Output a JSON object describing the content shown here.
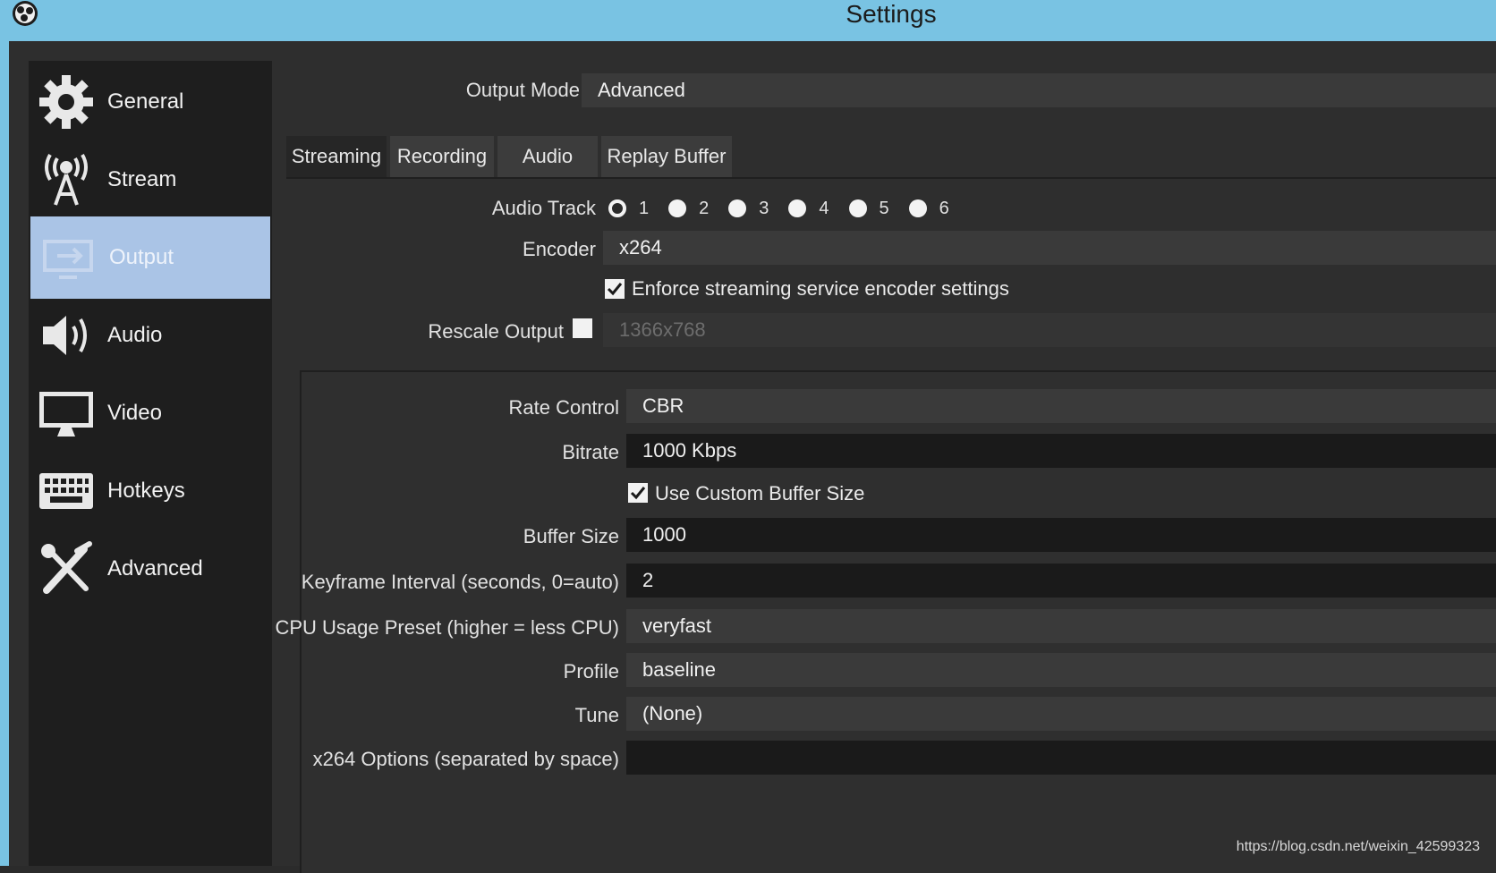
{
  "window": {
    "title": "Settings"
  },
  "sidebar": {
    "items": [
      {
        "label": "General",
        "icon": "gear-icon"
      },
      {
        "label": "Stream",
        "icon": "antenna-icon"
      },
      {
        "label": "Output",
        "icon": "output-icon",
        "active": true
      },
      {
        "label": "Audio",
        "icon": "speaker-icon"
      },
      {
        "label": "Video",
        "icon": "monitor-icon"
      },
      {
        "label": "Hotkeys",
        "icon": "keyboard-icon"
      },
      {
        "label": "Advanced",
        "icon": "tools-icon"
      }
    ]
  },
  "output": {
    "mode_label": "Output Mode",
    "mode_value": "Advanced",
    "tabs": [
      "Streaming",
      "Recording",
      "Audio",
      "Replay Buffer"
    ],
    "active_tab": "Streaming",
    "audio_track_label": "Audio Track",
    "audio_tracks": [
      "1",
      "2",
      "3",
      "4",
      "5",
      "6"
    ],
    "selected_track": "1",
    "encoder_label": "Encoder",
    "encoder_value": "x264",
    "enforce_label": "Enforce streaming service encoder settings",
    "enforce_checked": true,
    "rescale_label": "Rescale Output",
    "rescale_checked": false,
    "rescale_value": "1366x768",
    "rate_control_label": "Rate Control",
    "rate_control_value": "CBR",
    "bitrate_label": "Bitrate",
    "bitrate_value": "1000 Kbps",
    "custom_buffer_label": "Use Custom Buffer Size",
    "custom_buffer_checked": true,
    "buffer_size_label": "Buffer Size",
    "buffer_size_value": "1000",
    "keyframe_label": "Keyframe Interval (seconds, 0=auto)",
    "keyframe_value": "2",
    "cpu_preset_label": "CPU Usage Preset (higher = less CPU)",
    "cpu_preset_value": "veryfast",
    "profile_label": "Profile",
    "profile_value": "baseline",
    "tune_label": "Tune",
    "tune_value": "(None)",
    "x264_options_label": "x264 Options (separated by space)",
    "x264_options_value": ""
  },
  "watermark": "https://blog.csdn.net/weixin_42599323",
  "colors": {
    "titlebar": "#79c3e3",
    "active_item": "#aac4e6",
    "background": "#2e2e2e"
  }
}
